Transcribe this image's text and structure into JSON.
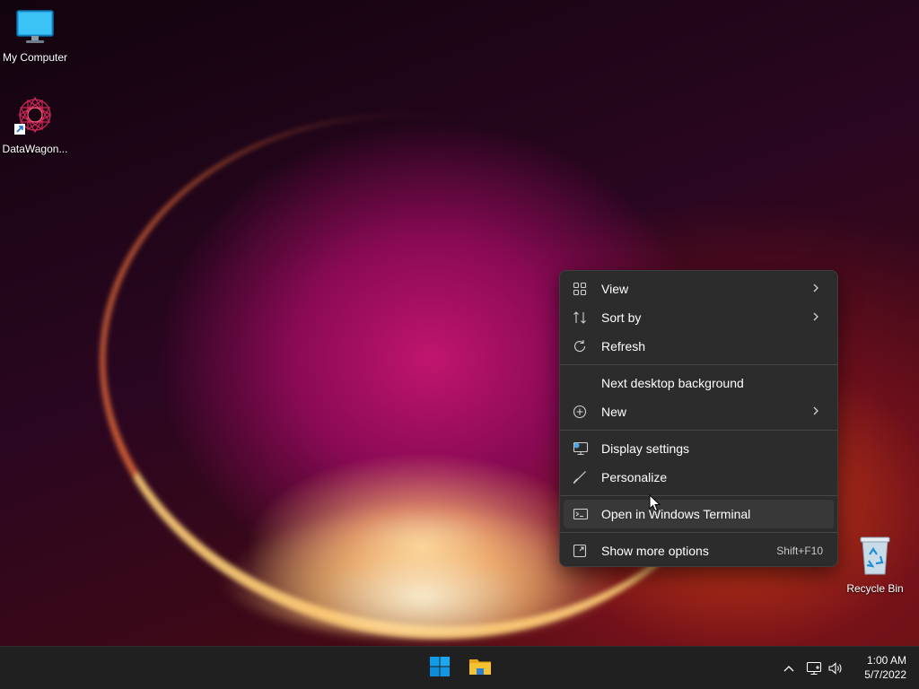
{
  "desktop": {
    "icons": [
      {
        "label": "My Computer",
        "icon": "monitor-icon"
      },
      {
        "label": "DataWagon...",
        "icon": "datawagon-app-icon"
      },
      {
        "label": "Recycle Bin",
        "icon": "recycle-bin-icon"
      }
    ]
  },
  "context_menu": {
    "items": [
      {
        "label": "View",
        "icon": "grid-icon",
        "submenu": true
      },
      {
        "label": "Sort by",
        "icon": "sort-icon",
        "submenu": true
      },
      {
        "label": "Refresh",
        "icon": "refresh-icon"
      },
      {
        "label": "Next desktop background",
        "icon": ""
      },
      {
        "label": "New",
        "icon": "plus-circle-icon",
        "submenu": true
      },
      {
        "label": "Display settings",
        "icon": "display-icon"
      },
      {
        "label": "Personalize",
        "icon": "brush-icon"
      },
      {
        "label": "Open in Windows Terminal",
        "icon": "terminal-icon",
        "highlighted": true
      },
      {
        "label": "Show more options",
        "icon": "expand-icon",
        "shortcut": "Shift+F10"
      }
    ]
  },
  "taskbar": {
    "apps": [
      {
        "name": "Start",
        "icon": "windows-start-icon"
      },
      {
        "name": "File Explorer",
        "icon": "folder-icon"
      }
    ],
    "tray": {
      "icons": [
        "chevron-up-icon",
        "network-icon",
        "volume-icon"
      ],
      "time": "1:00 AM",
      "date": "5/7/2022"
    }
  },
  "colors": {
    "menu_bg": "#2c2c2c",
    "menu_highlight": "#383838",
    "taskbar_bg": "#202020",
    "start_blue": "#0f9dea",
    "folder_yellow": "#f5c233"
  }
}
